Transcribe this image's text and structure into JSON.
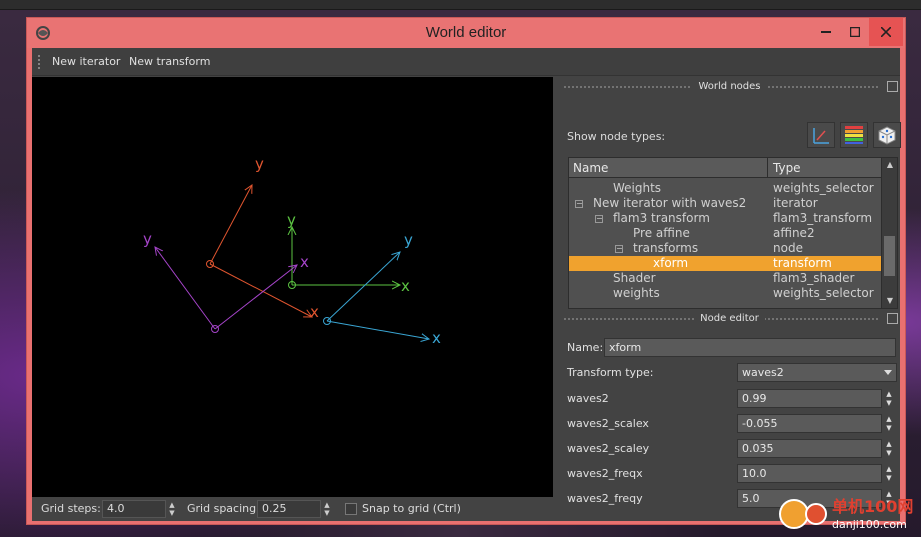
{
  "window": {
    "title": "World editor"
  },
  "toolbar": {
    "new_iterator": "New iterator",
    "new_transform": "New transform"
  },
  "viewport": {
    "axis_labels": {
      "x": "x",
      "y": "y"
    },
    "colors": {
      "red": "#e0552f",
      "green": "#5cc442",
      "purple": "#a544c9",
      "blue": "#3aa6d4"
    }
  },
  "statusbar": {
    "grid_steps_label": "Grid steps:",
    "grid_steps_value": "4.0",
    "grid_spacing_label": "Grid spacing:",
    "grid_spacing_value": "0.25",
    "snap_label": "Snap to grid (Ctrl)"
  },
  "world_nodes": {
    "title": "World nodes",
    "show_node_types_label": "Show node types:",
    "columns": [
      "Name",
      "Type"
    ],
    "rows": [
      {
        "name": "Weights",
        "type": "weights_selector"
      },
      {
        "name": "New iterator with waves2",
        "type": "iterator"
      },
      {
        "name": "flam3 transform",
        "type": "flam3_transform"
      },
      {
        "name": "Pre affine",
        "type": "affine2"
      },
      {
        "name": "transforms",
        "type": "node"
      },
      {
        "name": "xform",
        "type": "transform"
      },
      {
        "name": "Shader",
        "type": "flam3_shader"
      },
      {
        "name": "weights",
        "type": "weights_selector"
      }
    ],
    "selected_index": 5
  },
  "node_editor": {
    "title": "Node editor",
    "name_label": "Name:",
    "name_value": "xform",
    "transform_type_label": "Transform type:",
    "transform_type_value": "waves2",
    "params": [
      {
        "label": "waves2",
        "value": "0.99"
      },
      {
        "label": "waves2_scalex",
        "value": "-0.055"
      },
      {
        "label": "waves2_scaley",
        "value": "0.035"
      },
      {
        "label": "waves2_freqx",
        "value": "10.0"
      },
      {
        "label": "waves2_freqy",
        "value": "5.0"
      }
    ]
  },
  "watermark": {
    "text": "单机100网",
    "url": "danji100.com"
  }
}
